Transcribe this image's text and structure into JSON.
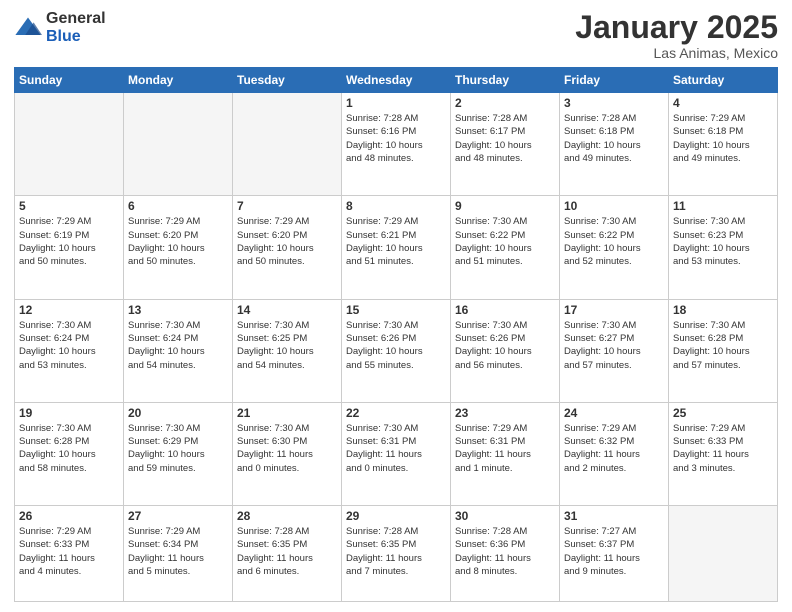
{
  "logo": {
    "general": "General",
    "blue": "Blue"
  },
  "header": {
    "month": "January 2025",
    "location": "Las Animas, Mexico"
  },
  "weekdays": [
    "Sunday",
    "Monday",
    "Tuesday",
    "Wednesday",
    "Thursday",
    "Friday",
    "Saturday"
  ],
  "weeks": [
    [
      {
        "day": "",
        "info": ""
      },
      {
        "day": "",
        "info": ""
      },
      {
        "day": "",
        "info": ""
      },
      {
        "day": "1",
        "info": "Sunrise: 7:28 AM\nSunset: 6:16 PM\nDaylight: 10 hours\nand 48 minutes."
      },
      {
        "day": "2",
        "info": "Sunrise: 7:28 AM\nSunset: 6:17 PM\nDaylight: 10 hours\nand 48 minutes."
      },
      {
        "day": "3",
        "info": "Sunrise: 7:28 AM\nSunset: 6:18 PM\nDaylight: 10 hours\nand 49 minutes."
      },
      {
        "day": "4",
        "info": "Sunrise: 7:29 AM\nSunset: 6:18 PM\nDaylight: 10 hours\nand 49 minutes."
      }
    ],
    [
      {
        "day": "5",
        "info": "Sunrise: 7:29 AM\nSunset: 6:19 PM\nDaylight: 10 hours\nand 50 minutes."
      },
      {
        "day": "6",
        "info": "Sunrise: 7:29 AM\nSunset: 6:20 PM\nDaylight: 10 hours\nand 50 minutes."
      },
      {
        "day": "7",
        "info": "Sunrise: 7:29 AM\nSunset: 6:20 PM\nDaylight: 10 hours\nand 50 minutes."
      },
      {
        "day": "8",
        "info": "Sunrise: 7:29 AM\nSunset: 6:21 PM\nDaylight: 10 hours\nand 51 minutes."
      },
      {
        "day": "9",
        "info": "Sunrise: 7:30 AM\nSunset: 6:22 PM\nDaylight: 10 hours\nand 51 minutes."
      },
      {
        "day": "10",
        "info": "Sunrise: 7:30 AM\nSunset: 6:22 PM\nDaylight: 10 hours\nand 52 minutes."
      },
      {
        "day": "11",
        "info": "Sunrise: 7:30 AM\nSunset: 6:23 PM\nDaylight: 10 hours\nand 53 minutes."
      }
    ],
    [
      {
        "day": "12",
        "info": "Sunrise: 7:30 AM\nSunset: 6:24 PM\nDaylight: 10 hours\nand 53 minutes."
      },
      {
        "day": "13",
        "info": "Sunrise: 7:30 AM\nSunset: 6:24 PM\nDaylight: 10 hours\nand 54 minutes."
      },
      {
        "day": "14",
        "info": "Sunrise: 7:30 AM\nSunset: 6:25 PM\nDaylight: 10 hours\nand 54 minutes."
      },
      {
        "day": "15",
        "info": "Sunrise: 7:30 AM\nSunset: 6:26 PM\nDaylight: 10 hours\nand 55 minutes."
      },
      {
        "day": "16",
        "info": "Sunrise: 7:30 AM\nSunset: 6:26 PM\nDaylight: 10 hours\nand 56 minutes."
      },
      {
        "day": "17",
        "info": "Sunrise: 7:30 AM\nSunset: 6:27 PM\nDaylight: 10 hours\nand 57 minutes."
      },
      {
        "day": "18",
        "info": "Sunrise: 7:30 AM\nSunset: 6:28 PM\nDaylight: 10 hours\nand 57 minutes."
      }
    ],
    [
      {
        "day": "19",
        "info": "Sunrise: 7:30 AM\nSunset: 6:28 PM\nDaylight: 10 hours\nand 58 minutes."
      },
      {
        "day": "20",
        "info": "Sunrise: 7:30 AM\nSunset: 6:29 PM\nDaylight: 10 hours\nand 59 minutes."
      },
      {
        "day": "21",
        "info": "Sunrise: 7:30 AM\nSunset: 6:30 PM\nDaylight: 11 hours\nand 0 minutes."
      },
      {
        "day": "22",
        "info": "Sunrise: 7:30 AM\nSunset: 6:31 PM\nDaylight: 11 hours\nand 0 minutes."
      },
      {
        "day": "23",
        "info": "Sunrise: 7:29 AM\nSunset: 6:31 PM\nDaylight: 11 hours\nand 1 minute."
      },
      {
        "day": "24",
        "info": "Sunrise: 7:29 AM\nSunset: 6:32 PM\nDaylight: 11 hours\nand 2 minutes."
      },
      {
        "day": "25",
        "info": "Sunrise: 7:29 AM\nSunset: 6:33 PM\nDaylight: 11 hours\nand 3 minutes."
      }
    ],
    [
      {
        "day": "26",
        "info": "Sunrise: 7:29 AM\nSunset: 6:33 PM\nDaylight: 11 hours\nand 4 minutes."
      },
      {
        "day": "27",
        "info": "Sunrise: 7:29 AM\nSunset: 6:34 PM\nDaylight: 11 hours\nand 5 minutes."
      },
      {
        "day": "28",
        "info": "Sunrise: 7:28 AM\nSunset: 6:35 PM\nDaylight: 11 hours\nand 6 minutes."
      },
      {
        "day": "29",
        "info": "Sunrise: 7:28 AM\nSunset: 6:35 PM\nDaylight: 11 hours\nand 7 minutes."
      },
      {
        "day": "30",
        "info": "Sunrise: 7:28 AM\nSunset: 6:36 PM\nDaylight: 11 hours\nand 8 minutes."
      },
      {
        "day": "31",
        "info": "Sunrise: 7:27 AM\nSunset: 6:37 PM\nDaylight: 11 hours\nand 9 minutes."
      },
      {
        "day": "",
        "info": ""
      }
    ]
  ]
}
